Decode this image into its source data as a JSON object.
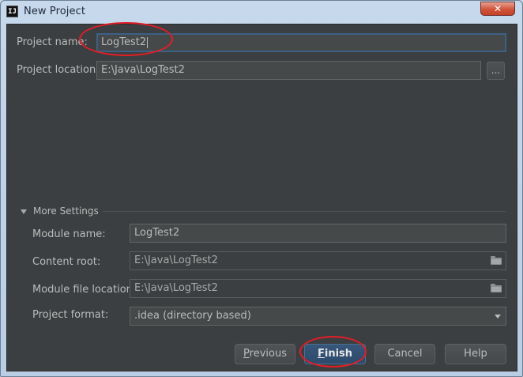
{
  "window": {
    "title": "New Project",
    "app_icon_text": "IJ",
    "close_glyph": "✕"
  },
  "project": {
    "name_label": "Project name:",
    "name_value": "LogTest2",
    "location_label": "Project location:",
    "location_value": "E:\\Java\\LogTest2",
    "browse_label": "..."
  },
  "more_settings": {
    "title": "More Settings",
    "expanded": true,
    "module_name_label": "Module name:",
    "module_name_value": "LogTest2",
    "content_root_label": "Content root:",
    "content_root_value": "E:\\Java\\LogTest2",
    "module_file_location_label": "Module file location:",
    "module_file_location_value": "E:\\Java\\LogTest2",
    "project_format_label": "Project format:",
    "project_format_value": ".idea (directory based)"
  },
  "buttons": {
    "previous": {
      "mnemonic": "P",
      "rest": "revious"
    },
    "finish": {
      "mnemonic": "F",
      "rest": "inish"
    },
    "cancel": "Cancel",
    "help": "Help"
  },
  "icons": {
    "app": "intellij-icon",
    "close": "close-icon",
    "folder": "folder-icon",
    "expand": "triangle-down-icon",
    "dropdown": "chevron-down-icon"
  },
  "colors": {
    "background": "#3c3f41",
    "field": "#45494a",
    "text": "#bbbbbb",
    "primary_button": "#365880",
    "annotation": "#e21e26"
  }
}
